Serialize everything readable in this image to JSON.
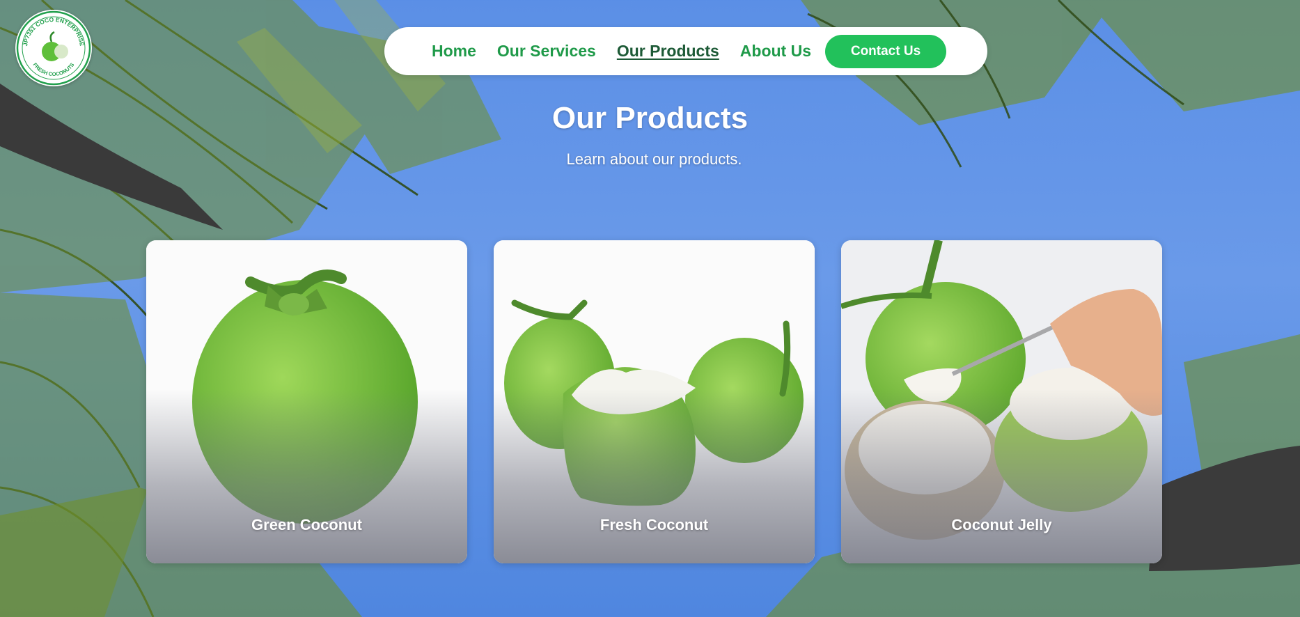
{
  "logo": {
    "top_text": "JP7351 COCO ENTERPRISE",
    "bottom_text": "FRESH COCONUTS"
  },
  "nav": {
    "items": [
      {
        "label": "Home",
        "active": false
      },
      {
        "label": "Our Services",
        "active": false
      },
      {
        "label": "Our Products",
        "active": true
      },
      {
        "label": "About Us",
        "active": false
      }
    ],
    "contact_label": "Contact Us"
  },
  "hero": {
    "title": "Our Products",
    "subtitle": "Learn about our products."
  },
  "products": [
    {
      "name": "Green Coconut"
    },
    {
      "name": "Fresh Coconut"
    },
    {
      "name": "Coconut Jelly"
    }
  ],
  "colors": {
    "nav_text": "#1f9a49",
    "nav_active": "#1d5a36",
    "contact_button": "#22c15b",
    "sky": "#5b8fe6"
  }
}
